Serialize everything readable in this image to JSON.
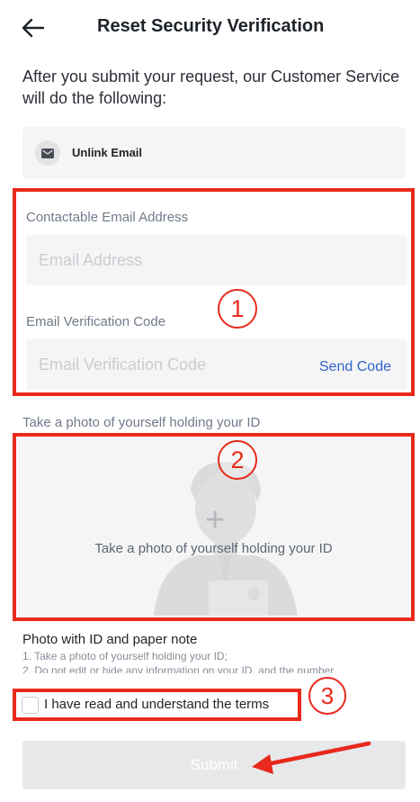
{
  "header": {
    "title": "Reset Security Verification"
  },
  "intro_text": "After you submit your request, our Customer Service will do the following:",
  "unlink": {
    "label": "Unlink Email"
  },
  "email_section": {
    "badge": "1",
    "email_label": "Contactable Email Address",
    "email_placeholder": "Email Address",
    "code_label": "Email Verification Code",
    "code_placeholder": "Email Verification Code",
    "send_code": "Send Code"
  },
  "photo_section": {
    "badge": "2",
    "label": "Take a photo of yourself holding your ID",
    "upload_text": "Take a photo of yourself holding your ID"
  },
  "note": {
    "title": "Photo with ID and paper note",
    "line1": "1. Take a photo of yourself holding your ID;",
    "line2": "2. Do not edit or hide any information on your ID, and the number"
  },
  "terms": {
    "badge": "3",
    "text": "I have read and understand the terms"
  },
  "submit": {
    "label": "Submit"
  },
  "colors": {
    "annotation": "#e8291c",
    "link": "#3064c8",
    "disabled_button": "#e6e8ea"
  },
  "icons": {
    "back": "arrow-left-icon",
    "email": "envelope-icon",
    "upload": "plus-icon"
  }
}
